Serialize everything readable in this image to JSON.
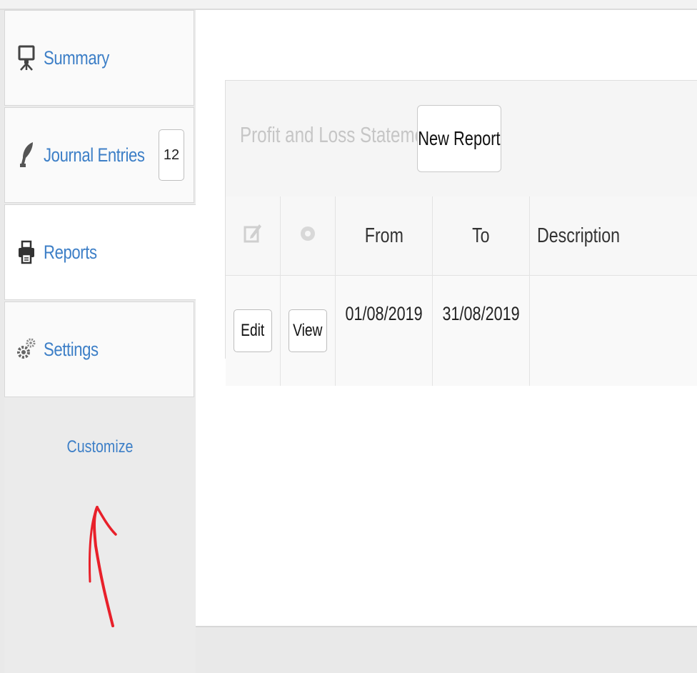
{
  "sidebar": {
    "items": [
      {
        "label": "Summary",
        "icon": "presentation-easel-icon"
      },
      {
        "label": "Journal Entries",
        "icon": "quill-pen-icon",
        "badge": "12"
      },
      {
        "label": "Reports",
        "icon": "printer-icon",
        "active": true
      },
      {
        "label": "Settings",
        "icon": "gears-icon"
      }
    ],
    "customize_label": "Customize"
  },
  "main": {
    "panel_title": "Profit and Loss Statement",
    "new_report_label": "New Report",
    "table": {
      "headers": {
        "edit_icon": "edit-icon",
        "view_icon": "view-icon",
        "from": "From",
        "to": "To",
        "description": "Description"
      },
      "rows": [
        {
          "edit_label": "Edit",
          "view_label": "View",
          "from": "01/08/2019",
          "to": "31/08/2019",
          "description": ""
        }
      ]
    }
  },
  "colors": {
    "link": "#3d7fc7",
    "annotation_arrow": "#e8202a"
  }
}
